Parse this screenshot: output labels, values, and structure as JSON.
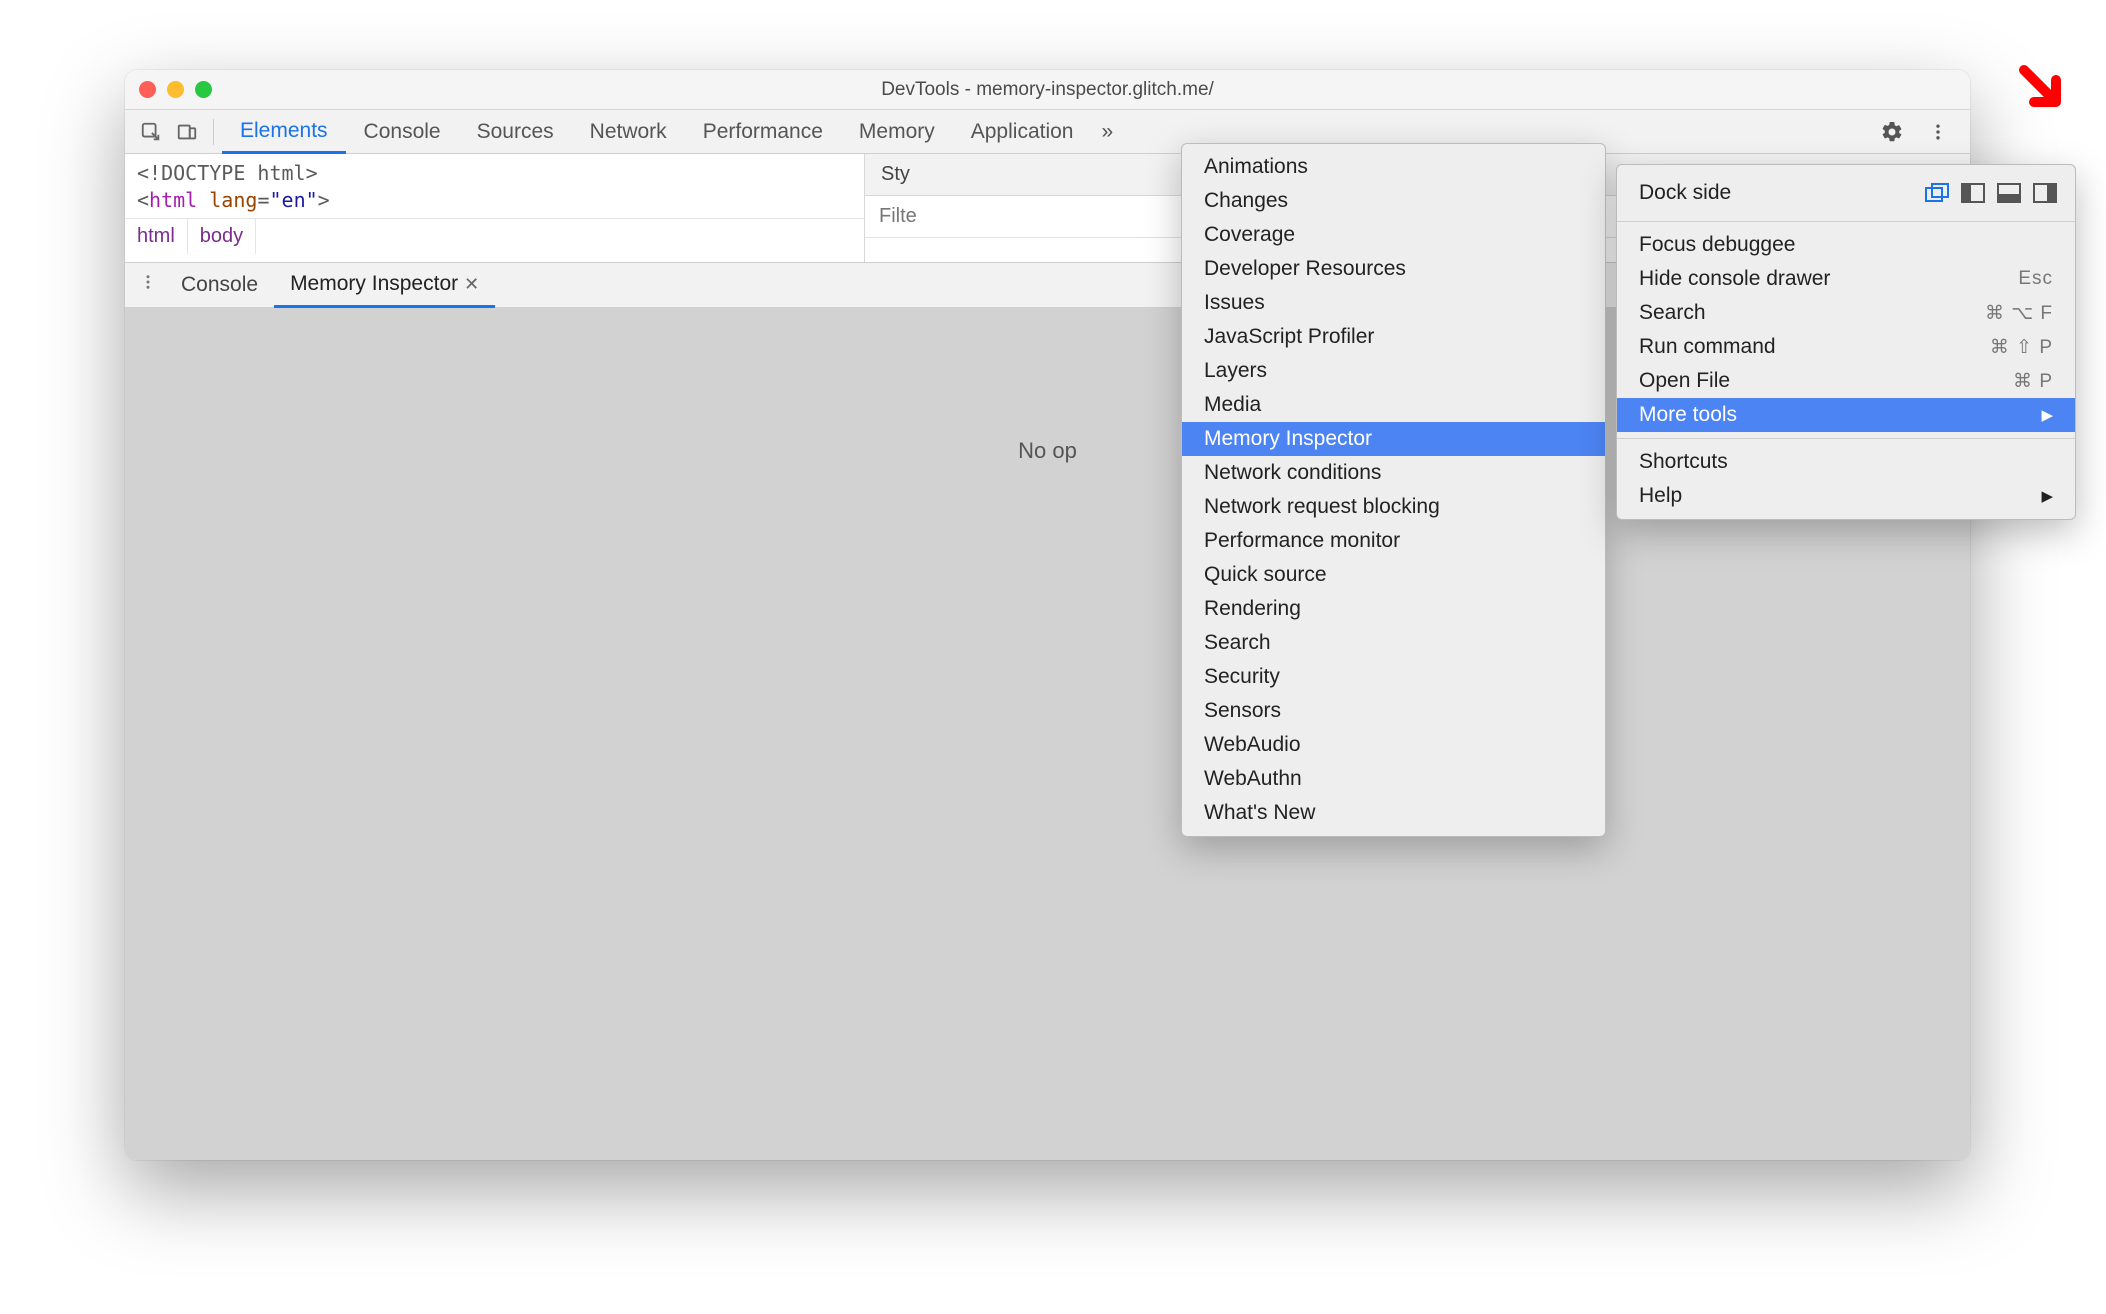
{
  "window": {
    "title": "DevTools - memory-inspector.glitch.me/"
  },
  "toolbar_tabs": {
    "elements": "Elements",
    "console": "Console",
    "sources": "Sources",
    "network": "Network",
    "performance": "Performance",
    "memory": "Memory",
    "application": "Application",
    "overflow": "»"
  },
  "elements_code": {
    "doctype": "<!DOCTYPE html>",
    "open_tag": "html",
    "attr_name": "lang",
    "attr_value": "\"en\""
  },
  "breadcrumb": {
    "html": "html",
    "body": "body"
  },
  "styles_panel": {
    "tab_styles": "Sty",
    "filter_label": "Filte"
  },
  "drawer": {
    "console": "Console",
    "memory_inspector": "Memory Inspector",
    "empty_text": "No op"
  },
  "main_menu": {
    "dock_side": "Dock side",
    "focus_debuggee": "Focus debuggee",
    "hide_console": "Hide console drawer",
    "hide_console_shortcut": "Esc",
    "search": "Search",
    "search_shortcut": "⌘ ⌥ F",
    "run_command": "Run command",
    "run_command_shortcut": "⌘ ⇧ P",
    "open_file": "Open File",
    "open_file_shortcut": "⌘ P",
    "more_tools": "More tools",
    "shortcuts": "Shortcuts",
    "help": "Help"
  },
  "tools_menu": {
    "items": [
      "Animations",
      "Changes",
      "Coverage",
      "Developer Resources",
      "Issues",
      "JavaScript Profiler",
      "Layers",
      "Media",
      "Memory Inspector",
      "Network conditions",
      "Network request blocking",
      "Performance monitor",
      "Quick source",
      "Rendering",
      "Search",
      "Security",
      "Sensors",
      "WebAudio",
      "WebAuthn",
      "What's New"
    ],
    "highlighted_index": 8
  }
}
